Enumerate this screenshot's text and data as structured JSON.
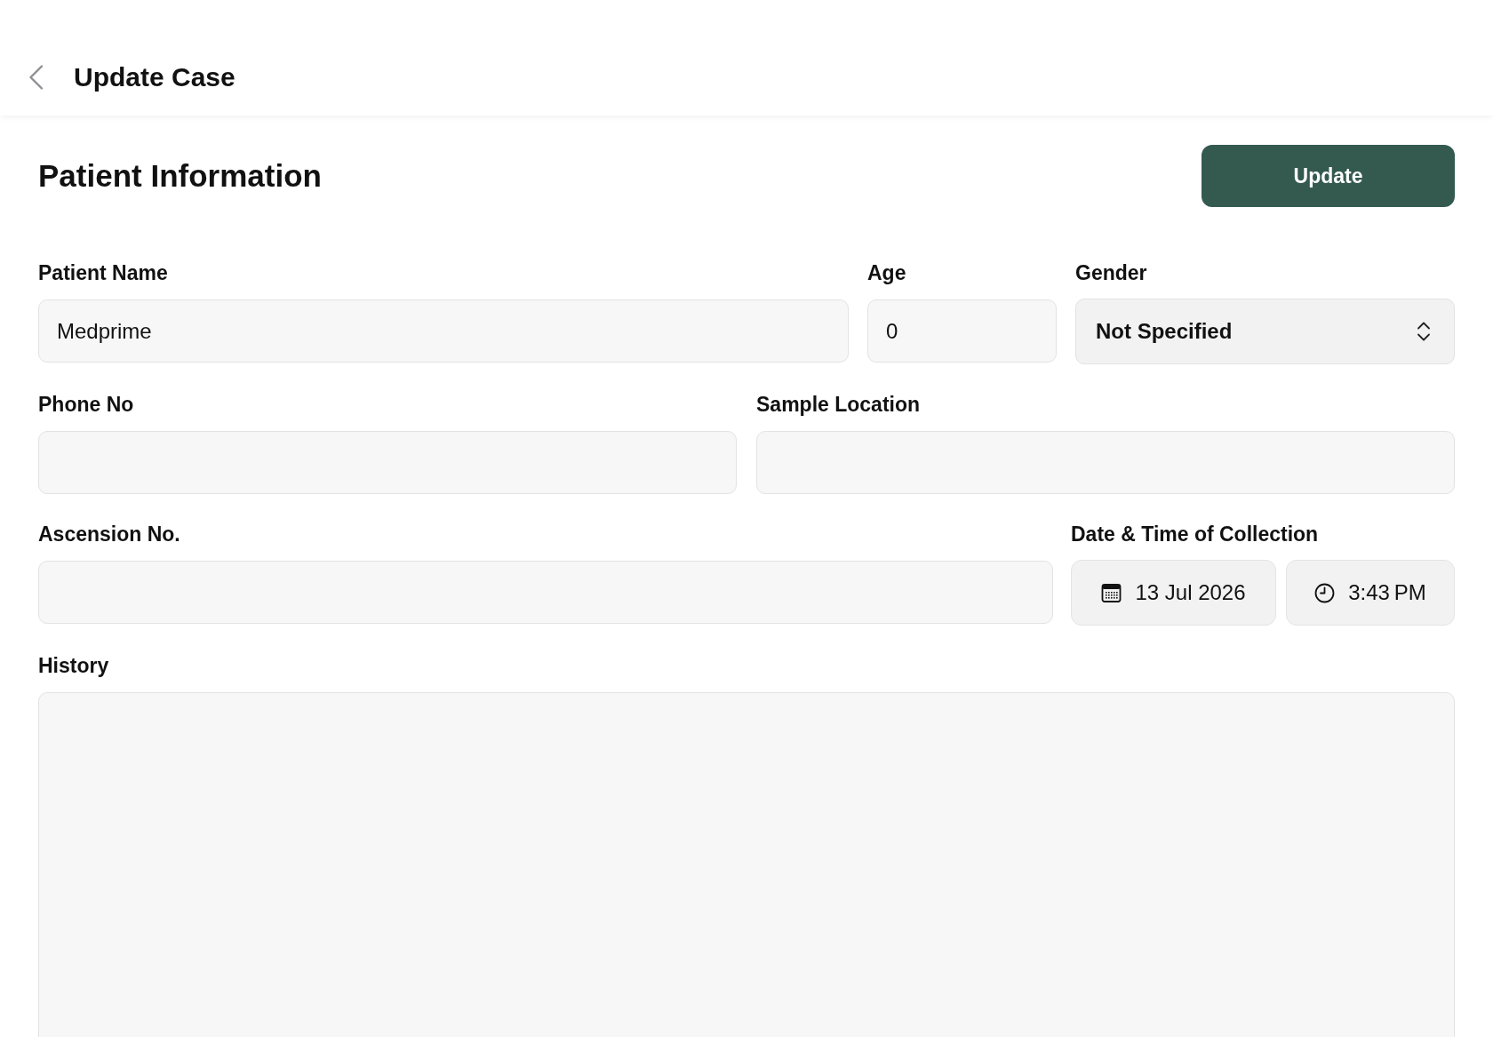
{
  "header": {
    "title": "Update Case"
  },
  "section": {
    "title": "Patient Information",
    "action": "Update"
  },
  "rows": [
    {
      "fields": [
        {
          "kind": "text",
          "label": "Patient Name",
          "value": "Medprime"
        },
        {
          "kind": "text",
          "label": "Age",
          "value": "0"
        },
        {
          "kind": "select",
          "label": "Gender",
          "value": "Not Specified"
        }
      ]
    },
    {
      "fields": [
        {
          "kind": "text",
          "label": "Phone No"
        },
        {
          "kind": "text",
          "label": "Sample Location"
        }
      ]
    },
    {
      "fields": [
        {
          "kind": "text",
          "label": "Ascension No."
        },
        {
          "kind": "datetime",
          "label": "Date & Time of Collection",
          "date": "13 Jul 2026",
          "time": "3:43 PM"
        }
      ]
    },
    {
      "fields": [
        {
          "kind": "textarea",
          "label": "History"
        }
      ]
    }
  ]
}
